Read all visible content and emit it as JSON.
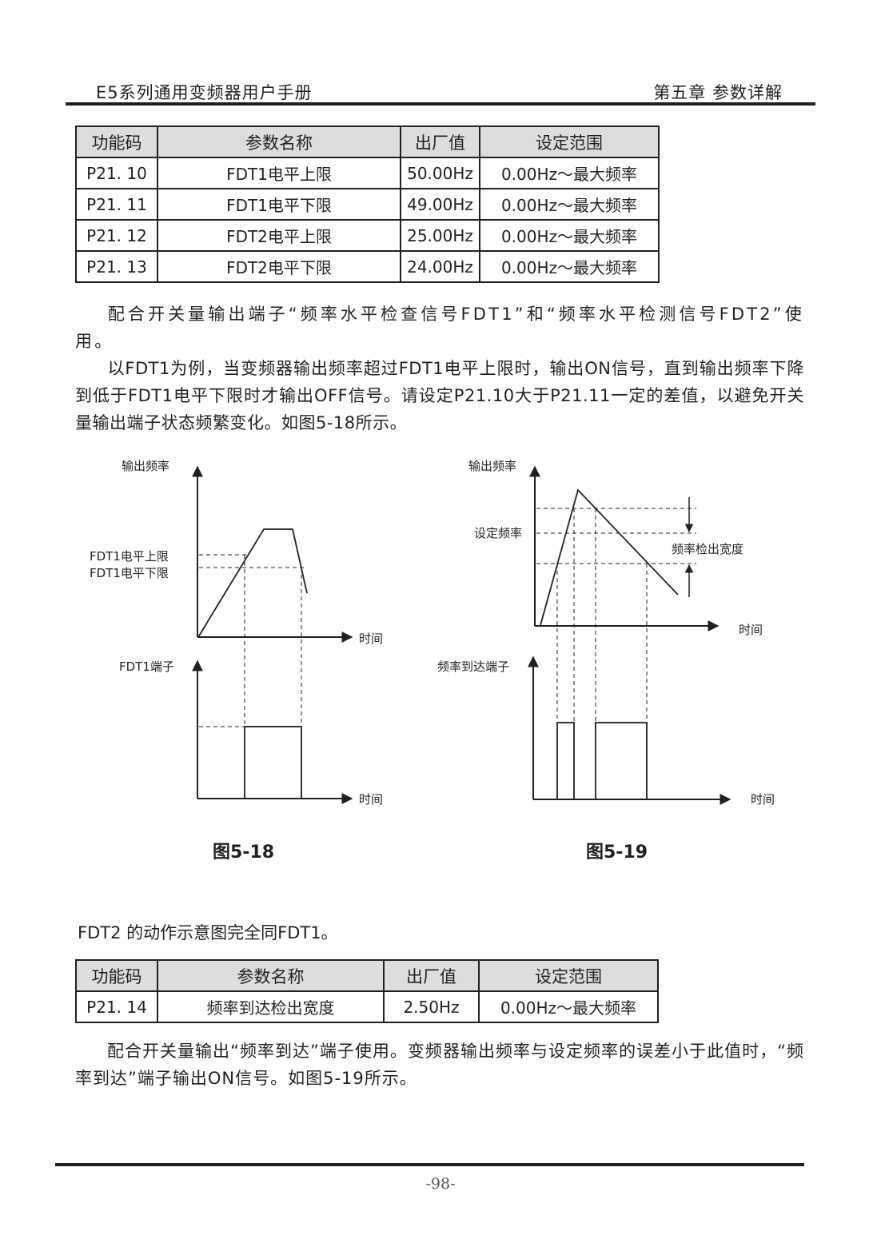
{
  "header": {
    "left": "E5系列通用变频器用户手册",
    "right": "第五章 参数详解"
  },
  "table1": {
    "headers": [
      "功能码",
      "参数名称",
      "出厂值",
      "设定范围"
    ],
    "rows": [
      [
        "P21. 10",
        "FDT1电平上限",
        "50.00Hz",
        "0.00Hz～最大频率"
      ],
      [
        "P21. 11",
        "FDT1电平下限",
        "49.00Hz",
        "0.00Hz～最大频率"
      ],
      [
        "P21. 12",
        "FDT2电平上限",
        "25.00Hz",
        "0.00Hz～最大频率"
      ],
      [
        "P21. 13",
        "FDT2电平下限",
        "24.00Hz",
        "0.00Hz～最大频率"
      ]
    ]
  },
  "para1": "配合开关量输出端子“频率水平检查信号FDT1”和“频率水平检测信号FDT2”使用。",
  "para2": "以FDT1为例，当变频器输出频率超过FDT1电平上限时，输出ON信号，直到输出频率下降到低于FDT1电平下限时才输出OFF信号。请设定P21.10大于P21.11一定的差值，以避免开关量输出端子状态频繁变化。如图5-18所示。",
  "fig518": {
    "y_label": "输出频率",
    "upper_label": "FDT1电平上限",
    "lower_label": "FDT1电平下限",
    "x_label_top": "时间",
    "terminal_label": "FDT1端子",
    "x_label_bottom": "时间",
    "caption": "图5-18"
  },
  "fig519": {
    "y_label": "输出频率",
    "setpoint_label": "设定频率",
    "width_label": "频率检出宽度",
    "x_label_top": "时间",
    "terminal_label": "频率到达端子",
    "x_label_bottom": "时间",
    "caption": "图5-19"
  },
  "para_fdt2": "FDT2 的动作示意图完全同FDT1。",
  "table2": {
    "headers": [
      "功能码",
      "参数名称",
      "出厂值",
      "设定范围"
    ],
    "rows": [
      [
        "P21. 14",
        "频率到达检出宽度",
        "2.50Hz",
        "0.00Hz～最大频率"
      ]
    ]
  },
  "para3": "配合开关量输出“频率到达”端子使用。变频器输出频率与设定频率的误差小于此值时，“频率到达”端子输出ON信号。如图5-19所示。",
  "footer": {
    "page_number": "-98-"
  }
}
